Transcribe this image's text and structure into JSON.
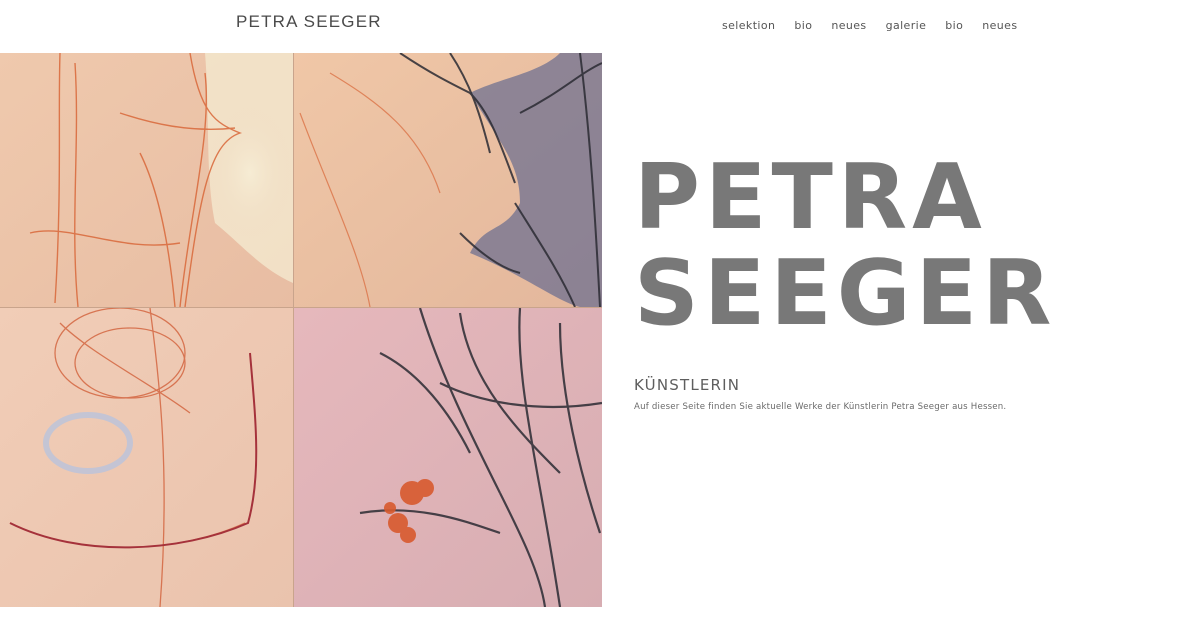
{
  "header": {
    "logo": "PETRA SEEGER",
    "nav": [
      "selektion",
      "bio",
      "neues",
      "galerie",
      "bio",
      "neues"
    ]
  },
  "hero": {
    "title_line1": "PETRA",
    "title_line2": "SEEGER",
    "subtitle": "KÜNSTLERIN",
    "text": "Auf dieser Seite finden Sie aktuelle Werke der Künstlerin Petra Seeger aus Hessen."
  },
  "colors": {
    "background": "#ffffff",
    "title": "#787878",
    "text": "#5a5a5a",
    "canvas_warm": "#eac3a6",
    "canvas_pink": "#dcb0b4",
    "line_orange": "#d9683a",
    "line_dark": "#2b2b33",
    "accent_blue_grey": "#6f7090"
  }
}
